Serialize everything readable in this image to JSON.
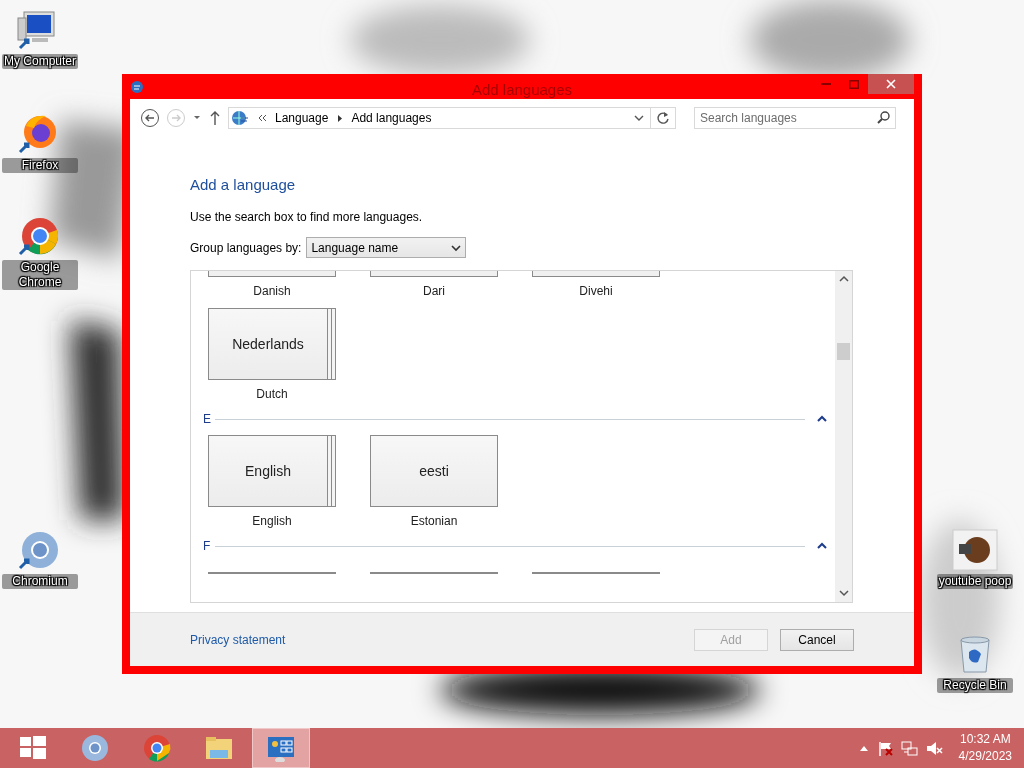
{
  "desktop_icons_left": [
    {
      "label": "My Computer",
      "kind": "computer"
    },
    {
      "label": "Firefox",
      "kind": "fox"
    },
    {
      "label": "Google Chrome",
      "kind": "chrome"
    },
    {
      "label": "Chromium",
      "kind": "chromium"
    }
  ],
  "desktop_icons_right": [
    {
      "label": "youtube poop",
      "kind": "video"
    },
    {
      "label": "Recycle Bin",
      "kind": "bin"
    }
  ],
  "window": {
    "title": "Add languages",
    "breadcrumb": [
      "Language",
      "Add languages"
    ],
    "search": {
      "placeholder": "Search languages"
    },
    "heading": "Add a language",
    "hint": "Use the search box to find more languages.",
    "group_by": {
      "label": "Group languages by:",
      "value": "Language name"
    },
    "sections": [
      {
        "languages": [
          {
            "kind": "clipped-bottom",
            "name": "Danish"
          },
          {
            "kind": "clipped-bottom",
            "name": "Dari"
          },
          {
            "kind": "clipped-bottom",
            "name": "Divehi"
          },
          {
            "kind": "tile",
            "native": "Nederlands",
            "name": "Dutch",
            "stacked": true
          }
        ]
      },
      {
        "letter": "E",
        "expanded": true,
        "languages": [
          {
            "kind": "tile",
            "native": "English",
            "name": "English",
            "stacked": true
          },
          {
            "kind": "tile",
            "native": "eesti",
            "name": "Estonian",
            "stacked": false
          }
        ]
      },
      {
        "letter": "F",
        "expanded": true,
        "languages": [
          {
            "kind": "clipped-top"
          },
          {
            "kind": "clipped-top"
          },
          {
            "kind": "clipped-top"
          }
        ]
      }
    ],
    "footer": {
      "link": "Privacy statement",
      "buttons": [
        {
          "label": "Add",
          "disabled": true
        },
        {
          "label": "Cancel",
          "disabled": false
        }
      ]
    }
  },
  "taskbar": {
    "apps": [
      {
        "kind": "start",
        "selected": false
      },
      {
        "kind": "chromium",
        "selected": false
      },
      {
        "kind": "chrome",
        "selected": false
      },
      {
        "kind": "folder",
        "selected": false
      },
      {
        "kind": "control-panel",
        "selected": true
      }
    ],
    "clock": {
      "time": "10:32 AM",
      "date": "4/29/2023"
    }
  }
}
